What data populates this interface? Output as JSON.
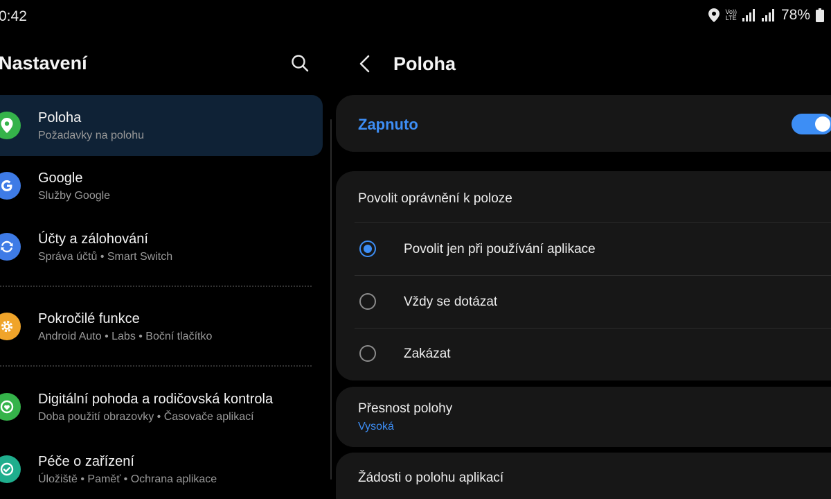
{
  "status_bar": {
    "time": "0:42",
    "battery_percent": "78%",
    "network_label_top": "Vo))",
    "network_label_bottom": "LTE",
    "icons": [
      "location-pin-icon",
      "volte-icon",
      "signal-icon",
      "signal-icon",
      "battery-icon"
    ]
  },
  "left_pane": {
    "title": "Nastavení",
    "search_icon": "search-icon",
    "items": [
      {
        "title": "Poloha",
        "subtitle": "Požadavky na polohu",
        "icon": "location-icon",
        "color": "#35b34a",
        "active": true
      },
      {
        "title": "Google",
        "subtitle": "Služby Google",
        "icon": "google-icon",
        "color": "#3e7be6"
      },
      {
        "title": "Účty a zálohování",
        "subtitle": "Správa účtů  •  Smart Switch",
        "icon": "sync-icon",
        "color": "#3e7be6"
      },
      {
        "title": "Pokročilé funkce",
        "subtitle": "Android Auto  •  Labs  •  Boční tlačítko",
        "icon": "gear-icon",
        "color": "#f0a42a"
      },
      {
        "title": "Digitální pohoda a rodičovská kontrola",
        "subtitle": "Doba použití obrazovky  •  Časovače aplikací",
        "icon": "wellbeing-icon",
        "color": "#35b34a"
      },
      {
        "title": "Péče o zařízení",
        "subtitle": "Úložiště  •  Paměť  •  Ochrana aplikace",
        "icon": "device-care-icon",
        "color": "#1fae8d"
      }
    ]
  },
  "right_pane": {
    "title": "Poloha",
    "toggle_label": "Zapnuto",
    "toggle_on": true,
    "permission_heading": "Povolit oprávnění k poloze",
    "options": [
      {
        "label": "Povolit jen při používání aplikace",
        "selected": true
      },
      {
        "label": "Vždy se dotázat",
        "selected": false
      },
      {
        "label": "Zakázat",
        "selected": false
      }
    ],
    "precision_title": "Přesnost polohy",
    "precision_value": "Vysoká",
    "requests_title": "Žádosti o polohu aplikací"
  },
  "colors": {
    "accent": "#3d8ef5",
    "background": "#000000",
    "card": "#171717",
    "active_item": "#0f2236"
  }
}
